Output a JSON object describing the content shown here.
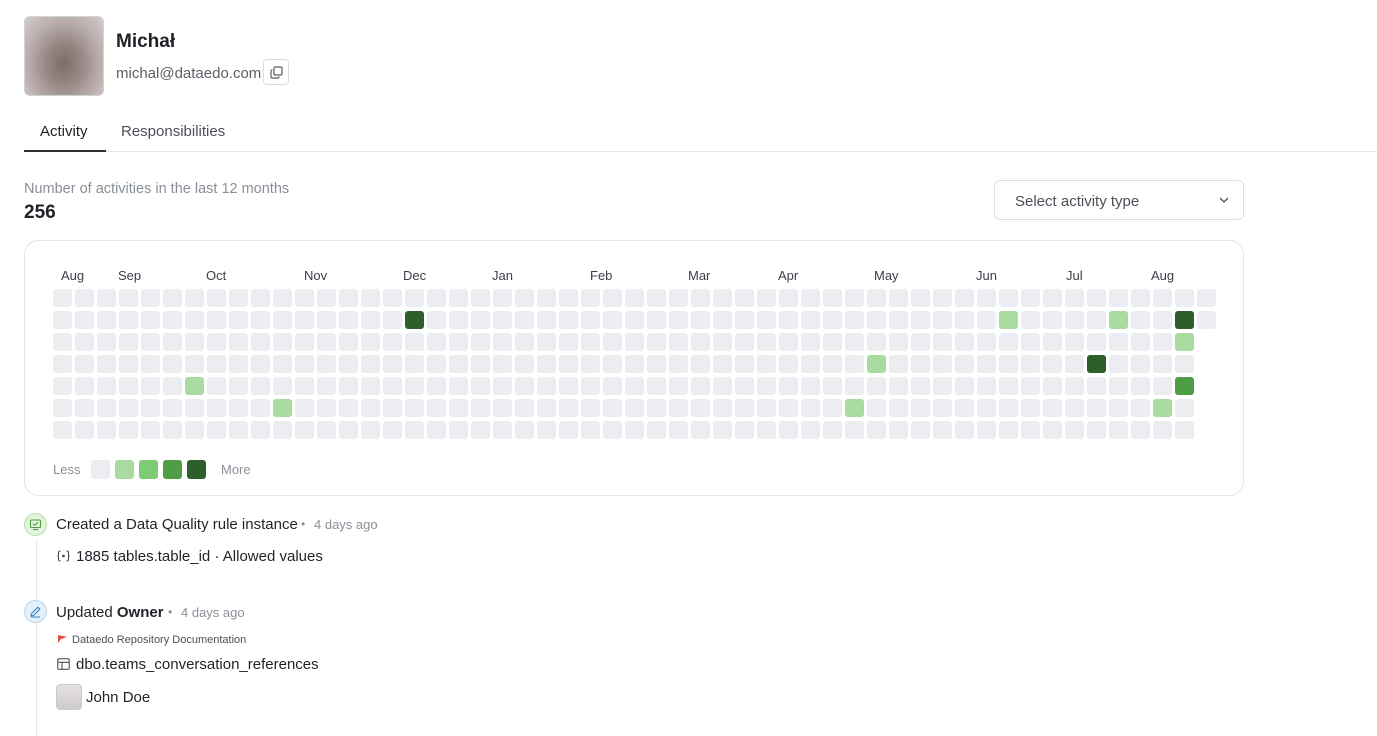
{
  "profile": {
    "name": "Michał",
    "email": "michal@dataedo.com"
  },
  "tabs": [
    {
      "label": "Activity",
      "active": true
    },
    {
      "label": "Responsibilities",
      "active": false
    }
  ],
  "stats": {
    "label": "Number of activities in the last 12 months",
    "count": "256"
  },
  "activity_filter": {
    "placeholder": "Select activity type"
  },
  "heatmap": {
    "months": [
      "Aug",
      "Sep",
      "Oct",
      "Nov",
      "Dec",
      "Jan",
      "Feb",
      "Mar",
      "Apr",
      "May",
      "Jun",
      "Jul",
      "Aug"
    ],
    "legend": {
      "less": "Less",
      "more": "More"
    },
    "colors": [
      "#ebedf0",
      "#a9dba0",
      "#7dcb72",
      "#4f9e46",
      "#2e5e29"
    ],
    "active_cells": [
      {
        "week": 16,
        "day": 1,
        "level": 4
      },
      {
        "week": 43,
        "day": 1,
        "level": 1
      },
      {
        "week": 48,
        "day": 1,
        "level": 1
      },
      {
        "week": 51,
        "day": 1,
        "level": 4
      },
      {
        "week": 51,
        "day": 2,
        "level": 1
      },
      {
        "week": 37,
        "day": 3,
        "level": 1
      },
      {
        "week": 47,
        "day": 3,
        "level": 4
      },
      {
        "week": 6,
        "day": 4,
        "level": 1
      },
      {
        "week": 51,
        "day": 4,
        "level": 3
      },
      {
        "week": 10,
        "day": 5,
        "level": 1
      },
      {
        "week": 36,
        "day": 5,
        "level": 1
      },
      {
        "week": 50,
        "day": 5,
        "level": 1
      }
    ]
  },
  "timeline": [
    {
      "icon": "data-quality-rule-icon",
      "title": "Created a Data Quality rule instance",
      "separator": "•",
      "time": "4 days ago",
      "detail": "1885 tables.table_id · Allowed values"
    },
    {
      "icon": "edit-icon",
      "title_prefix": "Updated ",
      "title_bold": "Owner",
      "separator": "•",
      "time": "4 days ago",
      "source": "Dataedo Repository Documentation",
      "object": "dbo.teams_conversation_references",
      "user": "John Doe"
    }
  ]
}
